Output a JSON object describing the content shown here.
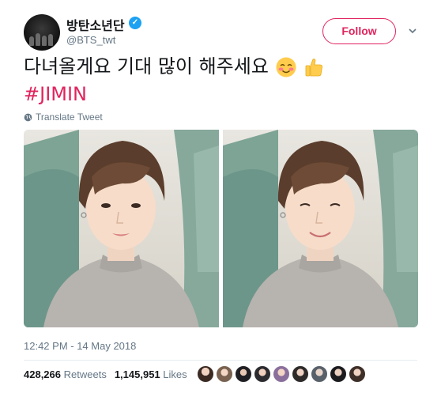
{
  "tweet": {
    "display_name": "방탄소년단",
    "handle": "@BTS_twt",
    "follow_label": "Follow",
    "text": "다녀올게요 기대 많이 해주세요",
    "hashtag": "#JIMIN",
    "translate_label": "Translate Tweet",
    "timestamp": "12:42 PM - 14 May 2018"
  },
  "stats": {
    "retweets_count": "428,266",
    "retweets_label": "Retweets",
    "likes_count": "1,145,951",
    "likes_label": "Likes"
  },
  "colors": {
    "brand_blue": "#1da1f2",
    "follow_red": "#e0245e",
    "muted": "#657786"
  },
  "icons": [
    "verified-badge-icon",
    "caret-down-icon",
    "globe-icon",
    "smiling-face-emoji",
    "thumbs-up-emoji"
  ],
  "photos": [
    "photo-1",
    "photo-2"
  ],
  "liker_avatars": [
    "liker-1",
    "liker-2",
    "liker-3",
    "liker-4",
    "liker-5",
    "liker-6",
    "liker-7",
    "liker-8",
    "liker-9"
  ]
}
